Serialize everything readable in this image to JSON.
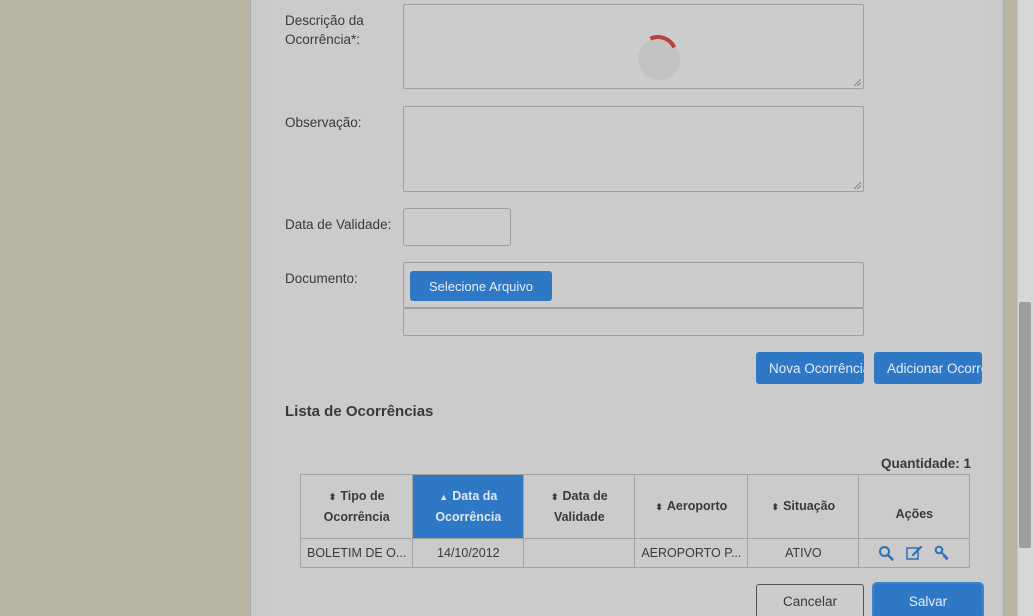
{
  "form": {
    "descricao_label": "Descrição da Ocorrência*:",
    "observacao_label": "Observação:",
    "data_validade_label": "Data de Validade:",
    "documento_label": "Documento:",
    "selecione_arquivo": "Selecione Arquivo",
    "nova_ocorrencia": "Nova Ocorrência",
    "adicionar_ocorrencia": "Adicionar Ocorrência"
  },
  "lista": {
    "title": "Lista de Ocorrências",
    "quantidade": "Quantidade: 1",
    "columns": [
      "Tipo de Ocorrência",
      "Data da Ocorrência",
      "Data de Validade",
      "Aeroporto",
      "Situação",
      "Ações"
    ],
    "rows": [
      {
        "tipo": "BOLETIM DE O...",
        "data": "14/10/2012",
        "validade": "",
        "aeroporto": "AEROPORTO P...",
        "situacao": "ATIVO"
      }
    ]
  },
  "footer": {
    "cancelar": "Cancelar",
    "salvar": "Salvar"
  },
  "icons": {
    "view": "search-icon",
    "edit": "edit-icon",
    "key": "key-icon"
  },
  "colors": {
    "primary": "#2f78c5",
    "spinner": "#b84040"
  }
}
